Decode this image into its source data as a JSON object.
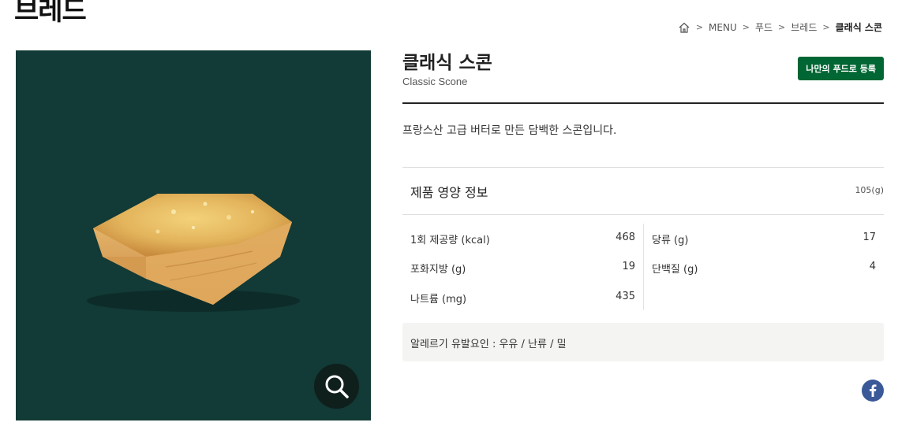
{
  "page": {
    "heading": "브레드"
  },
  "breadcrumb": {
    "items": [
      "MENU",
      "푸드",
      "브레드"
    ],
    "current": "클래식 스콘",
    "separator": ">"
  },
  "product": {
    "name": "클래식 스콘",
    "name_en": "Classic Scone",
    "register_label": "나만의 푸드로 등록",
    "description": "프랑스산 고급 버터로 만든 담백한 스콘입니다."
  },
  "nutrition": {
    "title": "제품 영양 정보",
    "serving": "105(g)",
    "left": [
      {
        "label": "1회 제공량 (kcal)",
        "value": "468"
      },
      {
        "label": "포화지방 (g)",
        "value": "19"
      },
      {
        "label": "나트륨 (mg)",
        "value": "435"
      }
    ],
    "right": [
      {
        "label": "당류 (g)",
        "value": "17"
      },
      {
        "label": "단백질 (g)",
        "value": "4"
      }
    ]
  },
  "allergy": {
    "text": "알레르기 유발요인 : 우유 / 난류 / 밀"
  },
  "colors": {
    "brand_green": "#006633",
    "image_bg": "#123a36",
    "facebook": "#3b5998"
  }
}
